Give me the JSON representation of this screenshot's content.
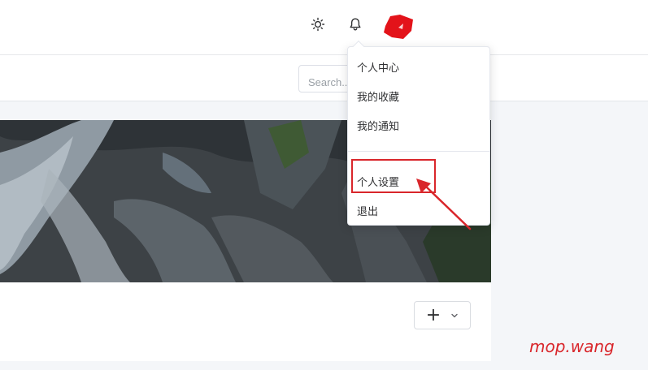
{
  "header": {
    "theme_icon": "sun-icon",
    "notification_icon": "bell-icon",
    "avatar_icon": "avatar-icon",
    "accent_color": "#d9262b"
  },
  "toolbar": {
    "search_placeholder": "Search..."
  },
  "user_menu": {
    "items": [
      {
        "label": "个人中心"
      },
      {
        "label": "我的收藏"
      },
      {
        "label": "我的通知"
      },
      {
        "label": "个人设置"
      },
      {
        "label": "退出"
      }
    ],
    "highlighted": "个人设置"
  },
  "content": {
    "add_button_icon": "plus-icon",
    "dropdown_icon": "chevron-down-icon"
  },
  "watermark": "mop.wang"
}
